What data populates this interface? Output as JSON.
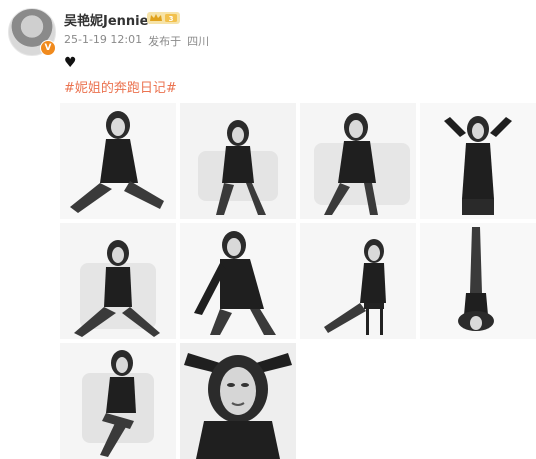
{
  "post": {
    "username": "吴艳妮Jennie",
    "vip_level": "3",
    "date": "25-1-19 12:01",
    "source_prefix": "发布于",
    "location": "四川",
    "emoji": "♥",
    "hashtag": "#妮姐的奔跑日记#"
  },
  "colors": {
    "hashtag": "#eb7350",
    "vip_badge": "#f2c14e",
    "verified_badge": "#f08a1d"
  },
  "photos": [
    {
      "id": "photo-1",
      "pose": "seated-on-floor"
    },
    {
      "id": "photo-2",
      "pose": "seated-on-chair"
    },
    {
      "id": "photo-3",
      "pose": "leaning-on-chair"
    },
    {
      "id": "photo-4",
      "pose": "arms-behind-head"
    },
    {
      "id": "photo-5",
      "pose": "seated-legs-crossed"
    },
    {
      "id": "photo-6",
      "pose": "hand-on-hip"
    },
    {
      "id": "photo-7",
      "pose": "seated-on-stool"
    },
    {
      "id": "photo-8",
      "pose": "legs-up-inverted"
    },
    {
      "id": "photo-9",
      "pose": "seated-legs-crossed-chair"
    },
    {
      "id": "photo-10",
      "pose": "close-up-portrait"
    }
  ]
}
